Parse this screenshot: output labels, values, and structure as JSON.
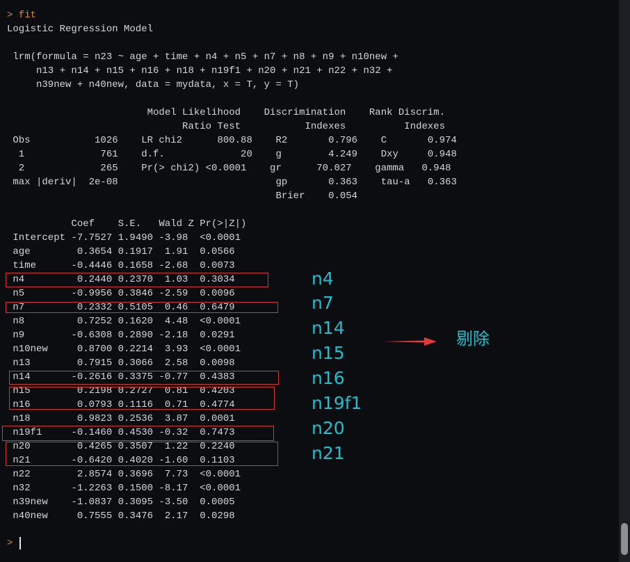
{
  "console": {
    "prompt": ">",
    "command": "fit",
    "lines": [
      "Logistic Regression Model",
      "",
      " lrm(formula = n23 ~ age + time + n4 + n5 + n7 + n8 + n9 + n10new +",
      "     n13 + n14 + n15 + n16 + n18 + n19f1 + n20 + n21 + n22 + n32 +",
      "     n39new + n40new, data = mydata, x = T, y = T)",
      "",
      "                        Model Likelihood    Discrimination    Rank Discrim.",
      "                              Ratio Test           Indexes          Indexes",
      " Obs           1026    LR chi2      800.88    R2       0.796    C       0.974",
      "  1             761    d.f.             20    g        4.249    Dxy     0.948",
      "  2             265    Pr(> chi2) <0.0001    gr      70.027    gamma   0.948",
      " max |deriv|  2e-08                           gp       0.363    tau-a   0.363",
      "                                              Brier    0.054",
      "",
      "           Coef    S.E.   Wald Z Pr(>|Z|)",
      " Intercept -7.7527 1.9490 -3.98  <0.0001",
      " age        0.3654 0.1917  1.91  0.0566",
      " time      -0.4446 0.1658 -2.68  0.0073",
      " n4         0.2440 0.2370  1.03  0.3034",
      " n5        -0.9956 0.3846 -2.59  0.0096",
      " n7         0.2332 0.5105  0.46  0.6479",
      " n8         0.7252 0.1620  4.48  <0.0001",
      " n9        -0.6308 0.2890 -2.18  0.0291",
      " n10new     0.8700 0.2214  3.93  <0.0001",
      " n13        0.7915 0.3066  2.58  0.0098",
      " n14       -0.2616 0.3375 -0.77  0.4383",
      " n15        0.2198 0.2727  0.81  0.4203",
      " n16        0.0793 0.1116  0.71  0.4774",
      " n18        0.9823 0.2536  3.87  0.0001",
      " n19f1     -0.1460 0.4530 -0.32  0.7473",
      " n20        0.4265 0.3507  1.22  0.2240",
      " n21       -0.6420 0.4020 -1.60  0.1103",
      " n22        2.8574 0.3696  7.73  <0.0001",
      " n32       -1.2263 0.1500 -8.17  <0.0001",
      " n39new    -1.0837 0.3095 -3.50  0.0005",
      " n40new     0.7555 0.3476  2.17  0.0298",
      ""
    ],
    "bottom_prompt": ">"
  },
  "annotations": {
    "labels": [
      "n4",
      "n7",
      "n14",
      "n15",
      "n16",
      "n19f1",
      "n20",
      "n21"
    ],
    "remove_label": "剔除",
    "text_color": "#1ec0d0",
    "box_color": "#d23a3a"
  }
}
